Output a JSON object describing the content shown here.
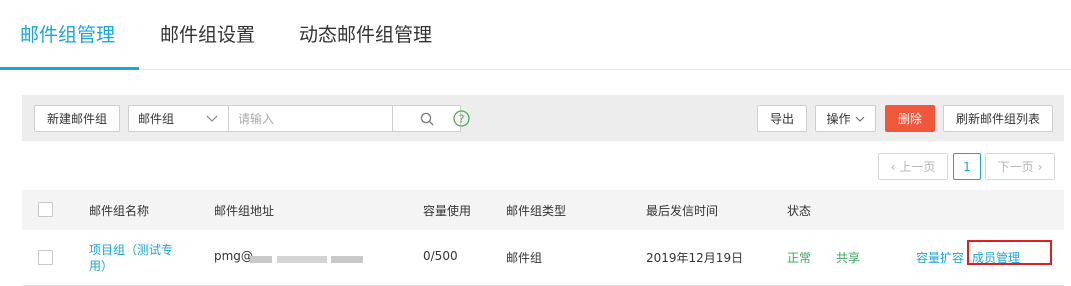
{
  "tabs": [
    {
      "label": "邮件组管理",
      "active": true
    },
    {
      "label": "邮件组设置",
      "active": false
    },
    {
      "label": "动态邮件组管理",
      "active": false
    }
  ],
  "toolbar": {
    "new_group_label": "新建邮件组",
    "search_select_value": "邮件组",
    "search_placeholder": "请输入",
    "export_label": "导出",
    "actions_label": "操作",
    "delete_label": "删除",
    "refresh_label": "刷新邮件组列表"
  },
  "pagination": {
    "prev_label": "上一页",
    "current_page": "1",
    "next_label": "下一页"
  },
  "table": {
    "columns": [
      "邮件组名称",
      "邮件组地址",
      "容量使用",
      "邮件组类型",
      "最后发信时间",
      "状态"
    ],
    "rows": [
      {
        "name_line1": "项目组（测试专",
        "name_line2": "用）",
        "address": "pmg@",
        "capacity": "0/500",
        "type": "邮件组",
        "last_sent": "2019年12月19日",
        "status": "正常",
        "share": "共享",
        "expand_label": "容量扩容",
        "members_label": "成员管理"
      }
    ]
  },
  "colors": {
    "accent": "#1ba6d8",
    "danger": "#f0573b",
    "status_green": "#3ba55c",
    "highlight": "#e02020"
  }
}
